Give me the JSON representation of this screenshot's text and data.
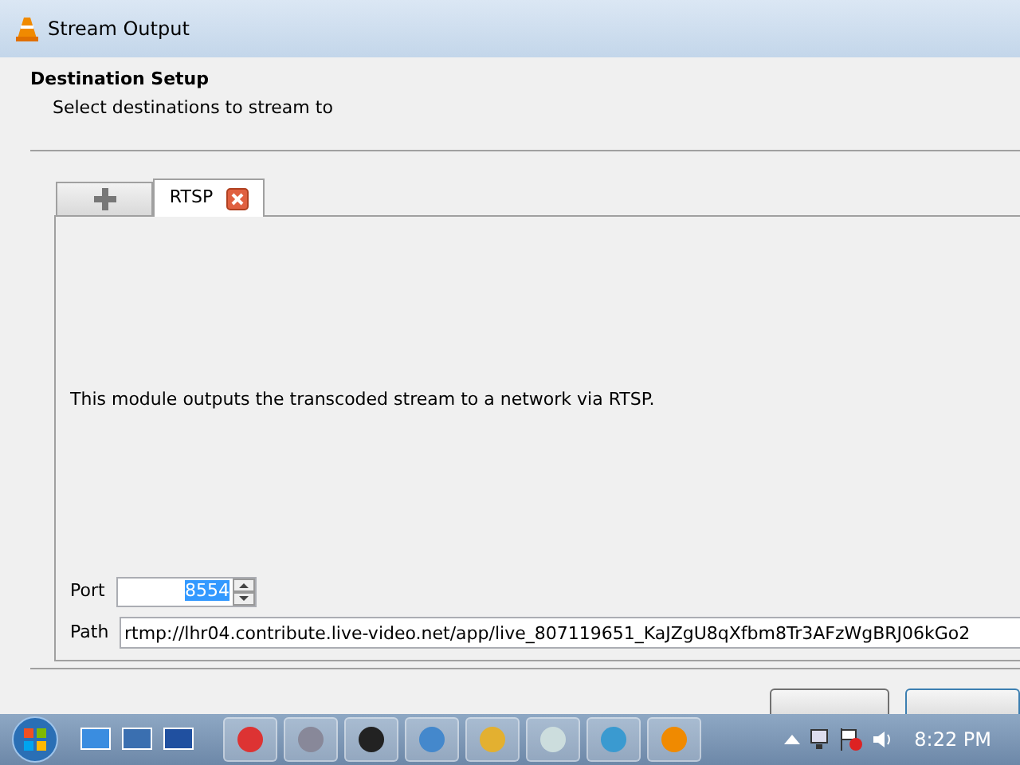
{
  "window": {
    "title": "Stream Output"
  },
  "header": {
    "title": "Destination Setup",
    "subtitle": "Select destinations to stream to"
  },
  "tabs": [
    {
      "kind": "add",
      "selected": false
    },
    {
      "kind": "module",
      "label": "RTSP",
      "selected": true,
      "closable": true
    }
  ],
  "panel": {
    "description": "This module outputs the transcoded stream to a network via RTSP.",
    "port": {
      "label": "Port",
      "value": "8554",
      "highlighted": true
    },
    "path": {
      "label": "Path",
      "value": "rtmp://lhr04.contribute.live-video.net/app/live_807119651_KaJZgU8qXfbm8Tr3AFzWgBRJ06kGo2"
    }
  },
  "taskbar": {
    "clock": "8:22 PM"
  }
}
